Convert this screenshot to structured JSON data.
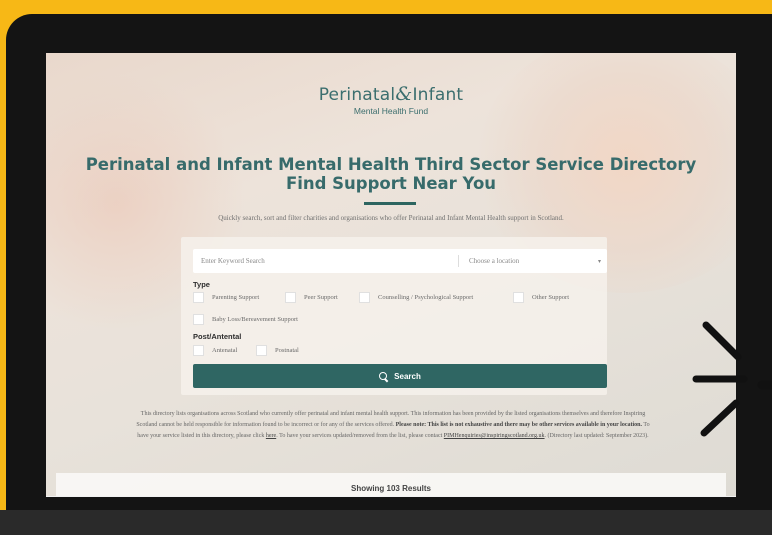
{
  "logo": {
    "name_part1": "Perinatal",
    "ampersand": "&",
    "name_part2": "Infant",
    "subtitle": "Mental Health Fund"
  },
  "hero": {
    "title_line1": "Perinatal and Infant Mental Health Third Sector Service Directory",
    "title_line2": "Find Support Near You",
    "intro": "Quickly search, sort and filter charities and organisations who offer Perinatal and Infant Mental Health support in Scotland."
  },
  "search": {
    "keyword_placeholder": "Enter Keyword Search",
    "location_placeholder": "Choose a location",
    "type_label": "Type",
    "type_options": [
      "Parenting Support",
      "Peer Support",
      "Counselling / Psychological Support",
      "Other Support",
      "Baby Loss/Bereavement Support"
    ],
    "antenatal_label": "Post/Antental",
    "antenatal_options": [
      "Antenatal",
      "Postnatal"
    ],
    "button_label": "Search"
  },
  "disclaimer": {
    "text1": "This directory lists organisations across Scotland who currently offer perinatal and infant mental health support. This information has been provided by the listed organisations themselves and therefore Inspiring Scotland cannot be held responsible for information found to be incorrect or for any of the services offered.",
    "bold": "Please note: This list is not exhaustive and there may be other services available in your location.",
    "text2": "To have your service listed in this directory, please click",
    "link": "here",
    "text3": ". To have your services updated/removed from the list, please contact",
    "email": "PIMHenquiries@inspiringscotland.org.uk",
    "text4": ". (Directory last updated: September 2023)."
  },
  "results": {
    "label": "Showing 103 Results"
  },
  "colors": {
    "frame": "#f7b816",
    "laptop": "#141414",
    "brand_teal": "#2f6663"
  }
}
